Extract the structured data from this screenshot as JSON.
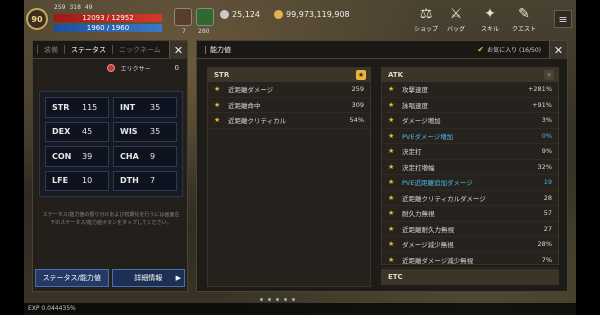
{
  "hud": {
    "level": "90",
    "stat_a": "259",
    "stat_b": "318",
    "stat_c": "49",
    "hp": "12093 / 12952",
    "mp": "1960 / 1960",
    "potion_count": "7",
    "item_count": "280",
    "currency_1": "25,124",
    "currency_2": "99,973,119,908",
    "menus": [
      {
        "label": "ショップ",
        "icon": "shop-icon"
      },
      {
        "label": "バッグ",
        "icon": "bag-icon"
      },
      {
        "label": "スキル",
        "icon": "skill-icon"
      },
      {
        "label": "クエスト",
        "icon": "quest-icon"
      }
    ]
  },
  "left_panel": {
    "tabs": [
      "装備",
      "ステータス",
      "ニックネーム"
    ],
    "active_tab": 1,
    "elixir_label": "エリクサー",
    "elixir_value": "0",
    "stats": [
      {
        "name": "STR",
        "value": "115"
      },
      {
        "name": "INT",
        "value": "35"
      },
      {
        "name": "DEX",
        "value": "45"
      },
      {
        "name": "WIS",
        "value": "35"
      },
      {
        "name": "CON",
        "value": "39"
      },
      {
        "name": "CHA",
        "value": "9"
      },
      {
        "name": "LFE",
        "value": "10"
      },
      {
        "name": "DTH",
        "value": "7"
      }
    ],
    "note": "ステータス/能力値の振り分けおよび初期化を行うには画面左下のステータス/能力値ボタンをタップしてください。",
    "button_status": "ステータス/能力値",
    "button_detail": "詳細情報"
  },
  "right_panel": {
    "title": "能力値",
    "favorites": "お気に入り (16/50)",
    "str": {
      "head": "STR",
      "rows": [
        {
          "label": "近距離ダメージ",
          "value": "259"
        },
        {
          "label": "近距離命中",
          "value": "309"
        },
        {
          "label": "近距離クリティカル",
          "value": "54%"
        }
      ]
    },
    "atk": {
      "head": "ATK",
      "rows": [
        {
          "label": "攻撃速度",
          "value": "+281%",
          "blue": false
        },
        {
          "label": "詠唱速度",
          "value": "+91%",
          "blue": false
        },
        {
          "label": "ダメージ増加",
          "value": "3%",
          "blue": false
        },
        {
          "label": "PVEダメージ増加",
          "value": "0%",
          "blue": true
        },
        {
          "label": "決定打",
          "value": "9%",
          "blue": false
        },
        {
          "label": "決定打増幅",
          "value": "32%",
          "blue": false
        },
        {
          "label": "PVE近距離追加ダメージ",
          "value": "19",
          "blue": true
        },
        {
          "label": "近距離クリティカルダメージ",
          "value": "28",
          "blue": false
        },
        {
          "label": "耐久力無視",
          "value": "57",
          "blue": false
        },
        {
          "label": "近距離耐久力無視",
          "value": "27",
          "blue": false
        },
        {
          "label": "ダメージ減少無視",
          "value": "28%",
          "blue": false
        },
        {
          "label": "近距離ダメージ減少無視",
          "value": "7%",
          "blue": false
        }
      ]
    },
    "etc": {
      "head": "ETC"
    }
  },
  "exp": "EXP 0.044435%"
}
